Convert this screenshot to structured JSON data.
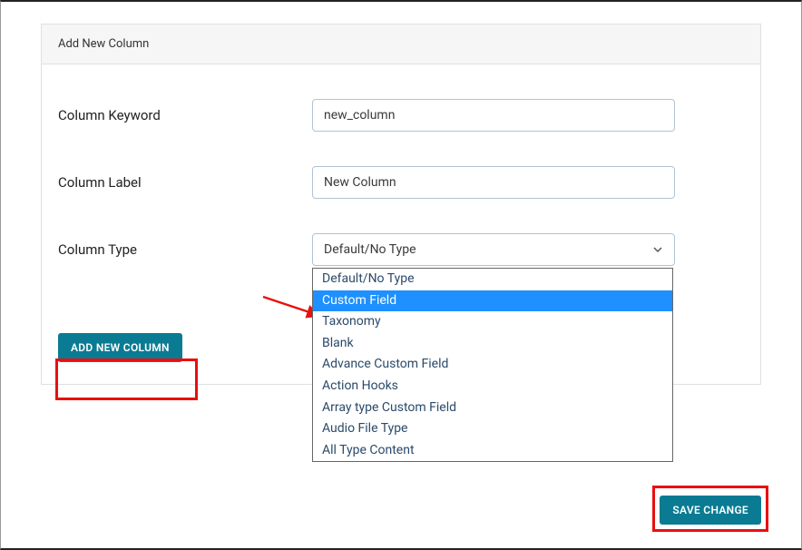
{
  "panel": {
    "title": "Add New Column"
  },
  "fields": {
    "keyword": {
      "label": "Column Keyword",
      "value": "new_column"
    },
    "columnLabel": {
      "label": "Column Label",
      "value": "New Column"
    },
    "columnType": {
      "label": "Column Type",
      "selected": "Default/No Type",
      "options": [
        "Default/No Type",
        "Custom Field",
        "Taxonomy",
        "Blank",
        "Advance Custom Field",
        "Action Hooks",
        "Array type Custom Field",
        "Audio File Type",
        "All Type Content"
      ],
      "highlightedIndex": 1
    }
  },
  "buttons": {
    "addNew": "ADD NEW COLUMN",
    "save": "SAVE CHANGE"
  }
}
